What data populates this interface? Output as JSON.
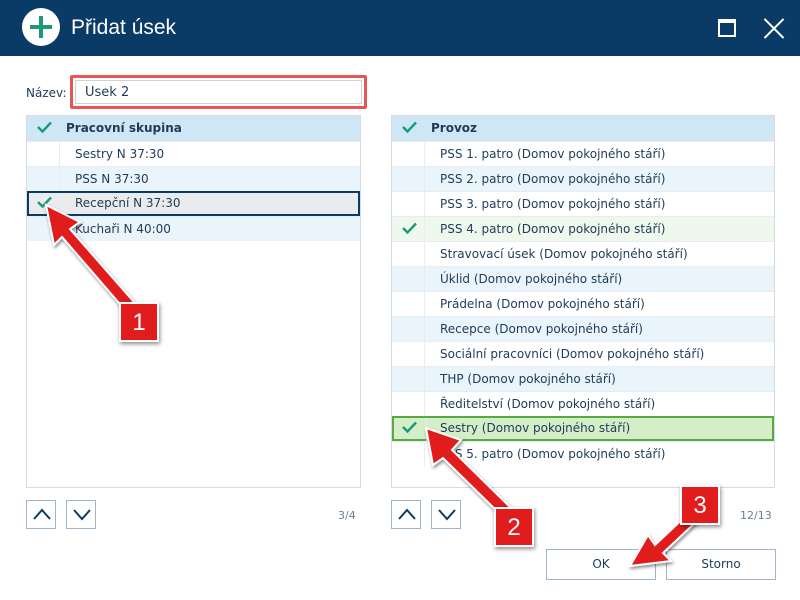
{
  "window": {
    "title": "Přidat úsek"
  },
  "name_field": {
    "label": "Název:",
    "value": "Úsek 2"
  },
  "left_list": {
    "header": "Pracovní skupina",
    "items": [
      {
        "label": "Sestry N 37:30",
        "checked": false
      },
      {
        "label": "PSS N 37:30",
        "checked": false
      },
      {
        "label": "Recepční N 37:30",
        "checked": true,
        "selected": true
      },
      {
        "label": "Kuchaři N 40:00",
        "checked": false
      }
    ],
    "counter": "3/4"
  },
  "right_list": {
    "header": "Provoz",
    "items": [
      {
        "label": "PSS 1. patro (Domov pokojného stáří)",
        "checked": false
      },
      {
        "label": "PSS 2. patro (Domov pokojného stáří)",
        "checked": false
      },
      {
        "label": "PSS 3. patro (Domov pokojného stáří)",
        "checked": false
      },
      {
        "label": "PSS 4. patro (Domov pokojného stáří)",
        "checked": true
      },
      {
        "label": "Stravovací úsek (Domov pokojného stáří)",
        "checked": false
      },
      {
        "label": "Úklid (Domov pokojného stáří)",
        "checked": false
      },
      {
        "label": "Prádelna (Domov pokojného stáří)",
        "checked": false
      },
      {
        "label": "Recepce (Domov pokojného stáří)",
        "checked": false
      },
      {
        "label": "Sociální pracovníci (Domov pokojného stáří)",
        "checked": false
      },
      {
        "label": "THP (Domov pokojného stáří)",
        "checked": false
      },
      {
        "label": "Ředitelství (Domov pokojného stáří)",
        "checked": false
      },
      {
        "label": "Sestry (Domov pokojného stáří)",
        "checked": true,
        "selected": true
      },
      {
        "label": "PSS 5. patro (Domov pokojného stáří)",
        "checked": false
      }
    ],
    "counter": "12/13"
  },
  "buttons": {
    "ok": "OK",
    "cancel": "Storno"
  },
  "annotations": [
    "1",
    "2",
    "3"
  ],
  "colors": {
    "titlebar": "#0a3b66",
    "accent": "#1a9a77",
    "header_bg": "#cfe6f4",
    "alt_row": "#e9f4fb",
    "selected_green": "#d4eec8",
    "callout_red": "#e01c1c"
  }
}
